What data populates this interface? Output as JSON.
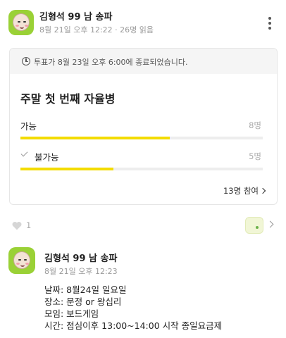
{
  "post": {
    "author": "김형석 99 남 송파",
    "meta": "8월 21일 오후 12:22 · 26명 읽음"
  },
  "poll": {
    "notice": "투표가 8월 23일 오후 6:00에 종료되었습니다.",
    "title": "주말 첫 번째 자율병",
    "options": [
      {
        "label": "가능",
        "count": "8명",
        "fraction": 0.615,
        "checked": false
      },
      {
        "label": "불가능",
        "count": "5명",
        "fraction": 0.385,
        "checked": true
      }
    ],
    "participants": "13명 참여",
    "bar_color": "#f3dc00"
  },
  "reactions": {
    "likes": "1"
  },
  "comment": {
    "author": "김형석 99 남 송파",
    "time": "8월 21일 오후 12:23",
    "lines": [
      "날짜: 8월24일 일요일",
      "장소: 문정 or 왕십리",
      "모임: 보드게임",
      "시간: 점심이후 13:00~14:00 시작 종일요금제"
    ]
  },
  "colors": {
    "avatar_bg": "#9ad136",
    "poll_fill": "#f3dc00"
  },
  "icons": [
    "avatar-icon",
    "more-icon",
    "clock-icon",
    "check-icon",
    "heart-icon",
    "chevron-right-icon"
  ]
}
